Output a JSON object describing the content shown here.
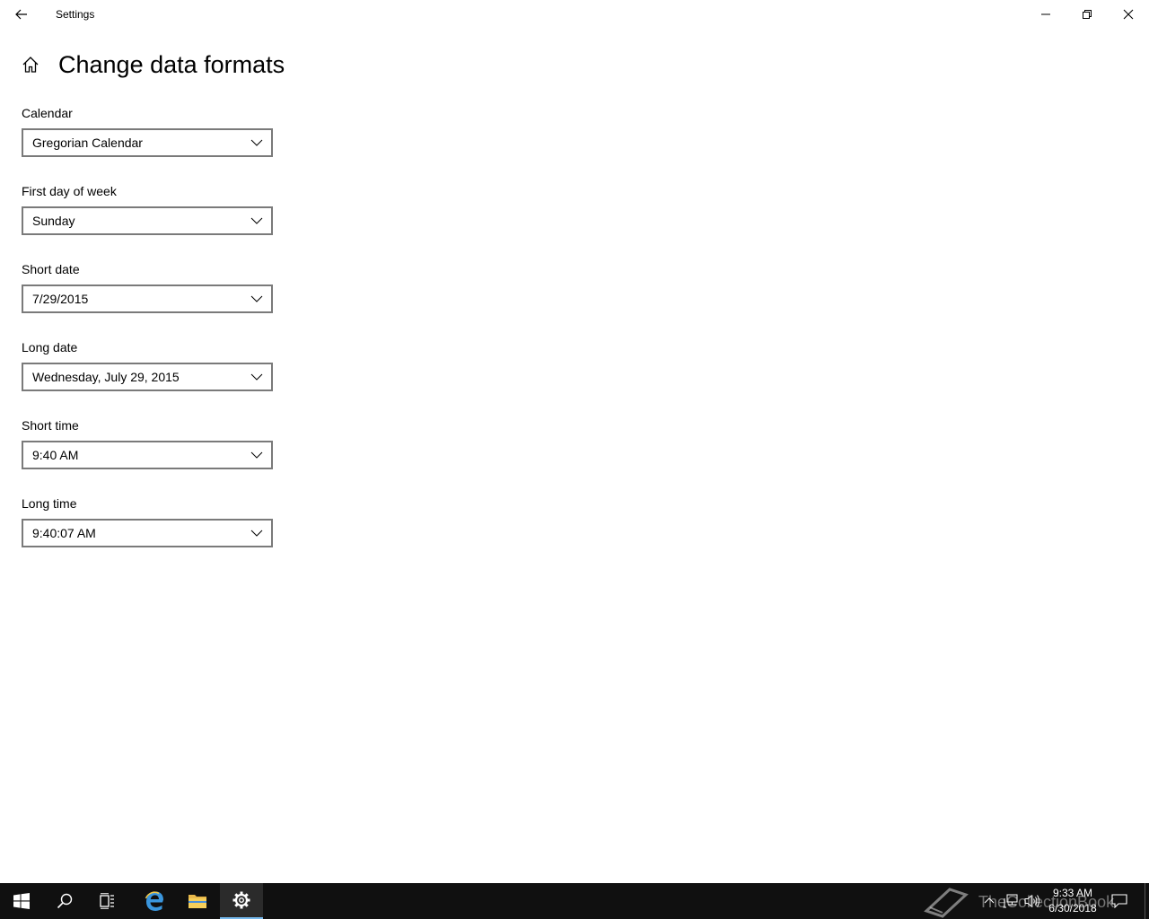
{
  "window": {
    "title": "Settings"
  },
  "page": {
    "title": "Change data formats"
  },
  "fields": [
    {
      "label": "Calendar",
      "value": "Gregorian Calendar"
    },
    {
      "label": "First day of week",
      "value": "Sunday"
    },
    {
      "label": "Short date",
      "value": "7/29/2015"
    },
    {
      "label": "Long date",
      "value": "Wednesday, July 29, 2015"
    },
    {
      "label": "Short time",
      "value": "9:40 AM"
    },
    {
      "label": "Long time",
      "value": "9:40:07 AM"
    }
  ],
  "taskbar": {
    "items": [
      "start-icon",
      "search-icon",
      "task-view-icon",
      "edge-icon",
      "file-explorer-icon",
      "settings-icon"
    ],
    "active_item": "settings-icon",
    "clock_time": "9:33 AM",
    "clock_date": "6/30/2018",
    "watermark": "TheCollectionBook"
  },
  "colors": {
    "taskbar_bg": "#101010",
    "accent": "#76b9ed",
    "combo_border": "#7a7a7a"
  }
}
